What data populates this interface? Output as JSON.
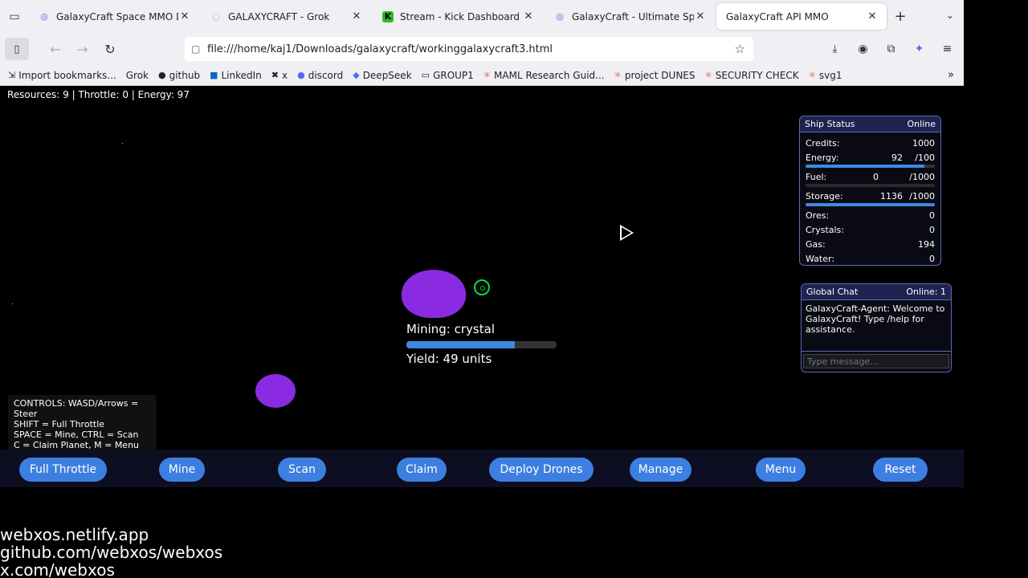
{
  "browser": {
    "tabs": [
      {
        "title": "GalaxyCraft Space MMO De",
        "favicon": "grok-icon"
      },
      {
        "title": "GALAXYCRAFT - Grok",
        "favicon": "grok-icon"
      },
      {
        "title": "Stream - Kick Dashboard",
        "favicon": "kick-icon"
      },
      {
        "title": "GalaxyCraft - Ultimate Space M",
        "favicon": "grok-icon"
      },
      {
        "title": "GalaxyCraft API MMO",
        "favicon": "page-icon"
      }
    ],
    "url": "file:///home/kaj1/Downloads/galaxycraft/workinggalaxycraft3.html",
    "bookmarks": [
      {
        "label": "Import bookmarks...",
        "icon": "import-icon"
      },
      {
        "label": "Grok",
        "icon": "grok-icon"
      },
      {
        "label": "github",
        "icon": "github-icon"
      },
      {
        "label": "LinkedIn",
        "icon": "linkedin-icon"
      },
      {
        "label": "x",
        "icon": "x-icon"
      },
      {
        "label": "discord",
        "icon": "discord-icon"
      },
      {
        "label": "DeepSeek",
        "icon": "deepseek-icon"
      },
      {
        "label": "GROUP1",
        "icon": "folder-icon"
      },
      {
        "label": "MAML Research Guid...",
        "icon": "claude-icon"
      },
      {
        "label": "project DUNES",
        "icon": "claude-icon"
      },
      {
        "label": "SECURITY CHECK",
        "icon": "claude-icon"
      },
      {
        "label": "svg1",
        "icon": "claude-icon"
      }
    ]
  },
  "game": {
    "hud": "Resources: 9 | Throttle: 0 | Energy: 97",
    "mining": {
      "label": "Mining: crystal",
      "yield": "Yield: 49 units",
      "progress": 0.72
    },
    "ship_status": {
      "title": "Ship Status",
      "status": "Online",
      "credits_label": "Credits:",
      "credits": "1000",
      "energy_label": "Energy:",
      "energy": "92",
      "energy_max": "/100",
      "energy_fill": 0.92,
      "fuel_label": "Fuel:",
      "fuel": "0",
      "fuel_max": "/1000",
      "fuel_fill": 0,
      "storage_label": "Storage:",
      "storage": "1136",
      "storage_max": "/1000",
      "storage_fill": 1,
      "ores_label": "Ores:",
      "ores": "0",
      "crystals_label": "Crystals:",
      "crystals": "0",
      "gas_label": "Gas:",
      "gas": "194",
      "water_label": "Water:",
      "water": "0"
    },
    "chat": {
      "title": "Global Chat",
      "online": "Online: 1",
      "message": "GalaxyCraft-Agent: Welcome to GalaxyCraft! Type /help for assistance.",
      "placeholder": "Type message..."
    },
    "controls": [
      "CONTROLS: WASD/Arrows = Steer",
      "SHIFT = Full Throttle",
      "SPACE = Mine, CTRL = Scan",
      "C = Claim Planet, M = Menu"
    ],
    "buttons": {
      "full_throttle": "Full Throttle",
      "mine": "Mine",
      "scan": "Scan",
      "claim": "Claim",
      "deploy_drones": "Deploy Drones",
      "manage": "Manage",
      "menu": "Menu",
      "reset": "Reset"
    },
    "colors": {
      "planet": "#8a2be2",
      "button": "#3d7fe0",
      "target": "#00e040"
    }
  },
  "footer": {
    "line1": "webxos.netlify.app",
    "line2": "github.com/webxos/webxos",
    "line3": "x.com/webxos"
  }
}
